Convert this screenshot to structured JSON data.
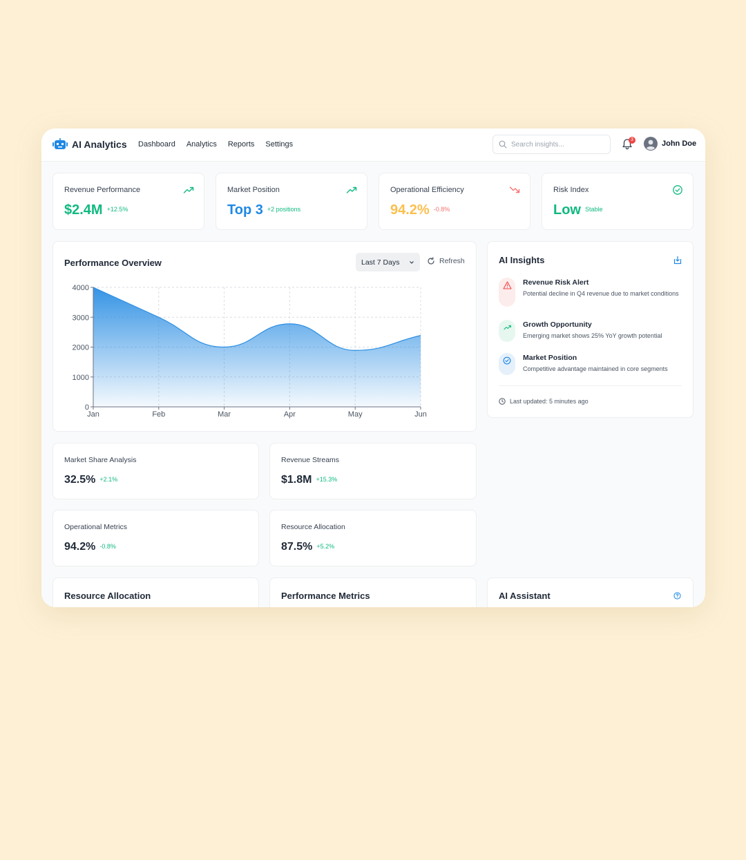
{
  "app": {
    "title": "AI Analytics"
  },
  "nav": [
    "Dashboard",
    "Analytics",
    "Reports",
    "Settings"
  ],
  "search": {
    "placeholder": "Search insights...",
    "value": ""
  },
  "notifications": {
    "count": "3"
  },
  "user": {
    "name": "John Doe"
  },
  "kpis": [
    {
      "label": "Revenue Performance",
      "value": "$2.4M",
      "delta": "+12.5%",
      "trend": "up",
      "color": "#10b981",
      "delta_color": "#10b981"
    },
    {
      "label": "Market Position",
      "value": "Top 3",
      "delta": "+2 positions",
      "trend": "up",
      "color": "#1e88e5",
      "delta_color": "#10b981"
    },
    {
      "label": "Operational Efficiency",
      "value": "94.2%",
      "delta": "-0.8%",
      "trend": "down",
      "color": "#fbbf4f",
      "delta_color": "#f87171"
    },
    {
      "label": "Risk Index",
      "value": "Low",
      "delta": "Stable",
      "trend": "check",
      "color": "#10b981",
      "delta_color": "#10b981"
    }
  ],
  "overview": {
    "title": "Performance Overview",
    "range": "Last 7 Days",
    "refresh": "Refresh"
  },
  "chart_data": {
    "type": "area",
    "categories": [
      "Jan",
      "Feb",
      "Mar",
      "Apr",
      "May",
      "Jun"
    ],
    "values": [
      4000,
      3000,
      2000,
      2780,
      1890,
      2390
    ],
    "yticks": [
      0,
      1000,
      2000,
      3000,
      4000
    ],
    "ylim": [
      0,
      4000
    ],
    "grid": true,
    "color": "#2b8ee3"
  },
  "metrics": [
    {
      "label": "Market Share Analysis",
      "value": "32.5%",
      "delta": "+2.1%",
      "delta_color": "#10b981"
    },
    {
      "label": "Revenue Streams",
      "value": "$1.8M",
      "delta": "+15.3%",
      "delta_color": "#10b981"
    },
    {
      "label": "Operational Metrics",
      "value": "94.2%",
      "delta": "-0.8%",
      "delta_color": "#10b981"
    },
    {
      "label": "Resource Allocation",
      "value": "87.5%",
      "delta": "+5.2%",
      "delta_color": "#10b981"
    }
  ],
  "insights": {
    "title": "AI Insights",
    "items": [
      {
        "title": "Revenue Risk Alert",
        "desc": "Potential decline in Q4 revenue due to market conditions",
        "icon": "warning-icon",
        "bg": "#fdecec",
        "color": "#ef4444"
      },
      {
        "title": "Growth Opportunity",
        "desc": "Emerging market shows 25% YoY growth potential",
        "icon": "trend-up-icon",
        "bg": "#e6f7ef",
        "color": "#10b981"
      },
      {
        "title": "Market Position",
        "desc": "Competitive advantage maintained in core segments",
        "icon": "check-circle-icon",
        "bg": "#e6f0fb",
        "color": "#1e88e5"
      }
    ],
    "updated": "Last updated: 5 minutes ago"
  },
  "bottom": {
    "resource": "Resource Allocation",
    "performance": "Performance Metrics",
    "assistant": "AI Assistant"
  }
}
